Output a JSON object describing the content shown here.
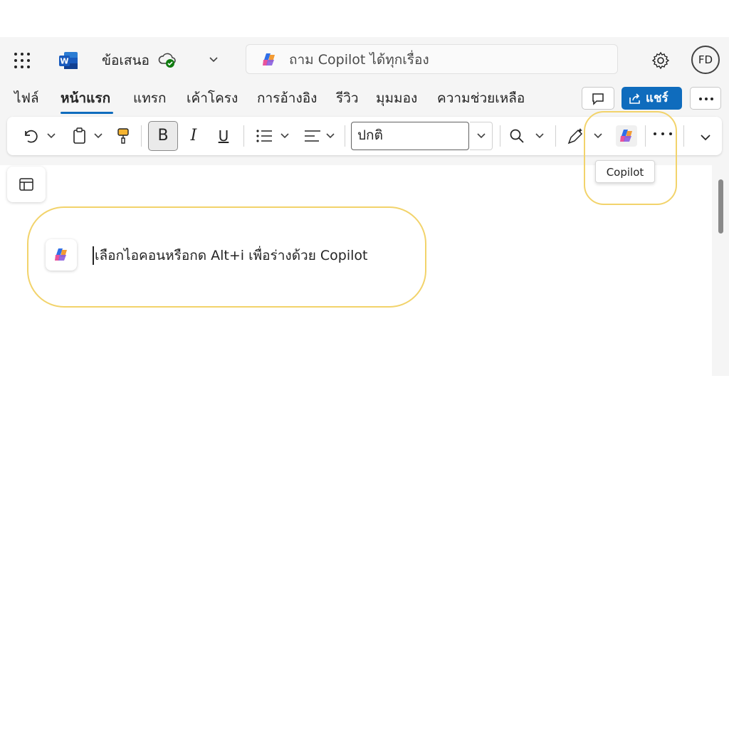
{
  "titlebar": {
    "app_icon": "word-logo-icon",
    "document_title": "ข้อเสนอ",
    "cloud_status_icon": "cloud-check-icon",
    "search_placeholder": "ถาม Copilot ได้ทุกเรื่อง",
    "user_initials": "FD"
  },
  "tabs": [
    {
      "label": "ไฟล์",
      "active": false
    },
    {
      "label": "หน้าแรก",
      "active": true
    },
    {
      "label": "แทรก",
      "active": false
    },
    {
      "label": "เค้าโครง",
      "active": false
    },
    {
      "label": "การอ้างอิง",
      "active": false
    },
    {
      "label": "รีวิว",
      "active": false
    },
    {
      "label": "มุมมอง",
      "active": false
    },
    {
      "label": "ความช่วยเหลือ",
      "active": false
    }
  ],
  "actions": {
    "share_label": "แชร์"
  },
  "ribbon": {
    "bold_label": "B",
    "italic_label": "I",
    "underline_label": "U",
    "style_value": "ปกติ",
    "copilot_tooltip": "Copilot"
  },
  "canvas": {
    "copilot_prompt": "เลือกไอคอนหรือกด Alt+i เพื่อร่างด้วย Copilot"
  },
  "colors": {
    "accent": "#0f6cbd",
    "highlight": "#f2d36b",
    "word_blue": "#185abd"
  }
}
